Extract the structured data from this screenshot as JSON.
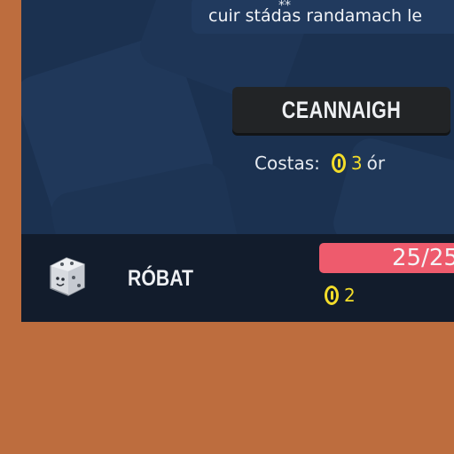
{
  "upgrade": {
    "description": "cuir stádas randamach le",
    "buy_label": "CEANNAIGH",
    "cost_label": "Costas:",
    "cost_amount": "3",
    "cost_unit": "ór",
    "coin_icon": "coin-icon"
  },
  "player": {
    "name": "RÓBAT",
    "hp_text": "25/25",
    "gold_amount": "2",
    "avatar_icon": "dice-icon"
  },
  "colors": {
    "background": "#bd6d3e",
    "panel": "#1b3150",
    "status_bar": "#121c2c",
    "button": "#222426",
    "health": "#ee5b6d",
    "gold": "#f2dc2a"
  }
}
